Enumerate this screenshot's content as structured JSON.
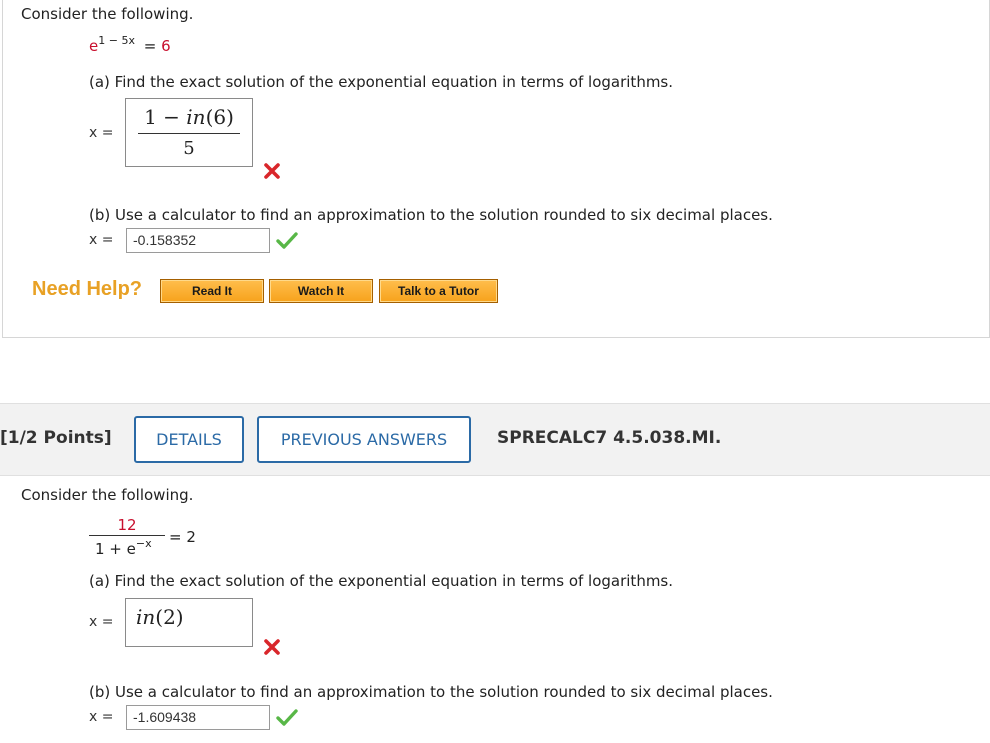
{
  "q1": {
    "intro": "Consider the following.",
    "equation": {
      "base": "e",
      "exponent": "1 − 5x",
      "eq": "= 6"
    },
    "part_a": {
      "prompt": "(a) Find the exact solution of the exponential equation in terms of logarithms.",
      "x_label": "x =",
      "answer_numerator": "1 − in(6)",
      "answer_denominator": "5",
      "status": "incorrect"
    },
    "part_b": {
      "prompt": "(b) Use a calculator to find an approximation to the solution rounded to six decimal places.",
      "x_label": "x =",
      "value": "-0.158352",
      "status": "correct"
    },
    "need_help": {
      "label": "Need Help?",
      "buttons": [
        "Read It",
        "Watch It",
        "Talk to a Tutor"
      ]
    }
  },
  "q2": {
    "points": "[1/2 Points]",
    "details_label": "DETAILS",
    "previous_answers_label": "PREVIOUS ANSWERS",
    "code": "SPRECALC7 4.5.038.MI.",
    "intro": "Consider the following.",
    "equation": {
      "numerator": "12",
      "denominator": "1 + e",
      "denominator_exp": "−x",
      "eq": "= 2"
    },
    "part_a": {
      "prompt": "(a) Find the exact solution of the exponential equation in terms of logarithms.",
      "x_label": "x =",
      "answer": "in(2)",
      "status": "incorrect"
    },
    "part_b": {
      "prompt": "(b) Use a calculator to find an approximation to the solution rounded to six decimal places.",
      "x_label": "x =",
      "value": "-1.609438",
      "status": "correct"
    }
  },
  "colors": {
    "accent_blue": "#2b6aa6",
    "help_orange": "#e8a125",
    "error_red": "#c8102e",
    "ok_green": "#4caf50"
  }
}
